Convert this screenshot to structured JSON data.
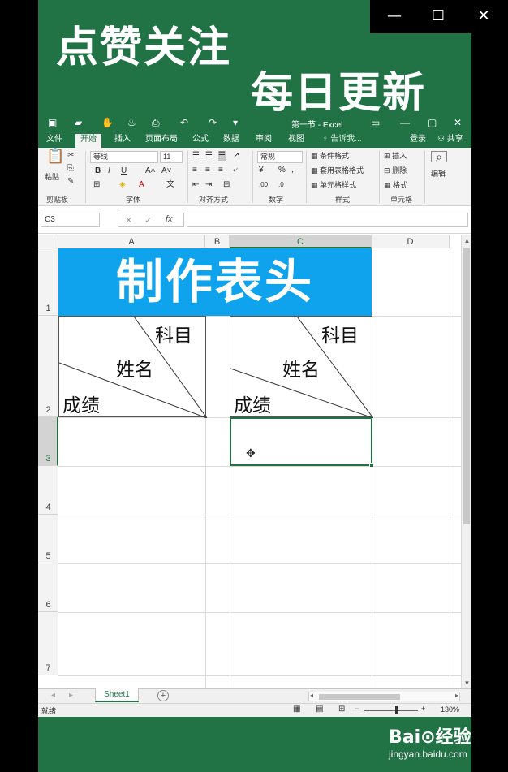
{
  "window_controls": {
    "minimize": "—",
    "maximize": "☐",
    "close": "✕"
  },
  "promo": {
    "line1": "点赞关注",
    "line2": "每日更新"
  },
  "excel": {
    "title": "第一节 - Excel",
    "ribbon_tabs": [
      "文件",
      "开始",
      "插入",
      "页面布局",
      "公式",
      "数据",
      "审阅",
      "视图"
    ],
    "tell_me": "♀ 告诉我...",
    "login": "登录",
    "share": "共享",
    "font_name": "等线",
    "font_size": "11",
    "number_format": "常规",
    "groups": {
      "clipboard": "剪贴板",
      "font": "字体",
      "alignment": "对齐方式",
      "number": "数字",
      "styles": "样式",
      "cells": "单元格"
    },
    "styles": {
      "conditional": "条件格式",
      "table": "套用表格格式",
      "cell": "单元格样式"
    },
    "cells": {
      "insert": "插入",
      "delete": "删除",
      "format": "格式"
    },
    "paste": "粘贴",
    "edit": "编辑",
    "name_box": "C3",
    "columns": [
      "A",
      "B",
      "C",
      "D"
    ],
    "rows": [
      "1",
      "2",
      "3",
      "4",
      "5",
      "6",
      "7"
    ],
    "header_cell": "制作表头",
    "diag_labels": {
      "subject": "科目",
      "name": "姓名",
      "score": "成绩"
    },
    "sheet_tab": "Sheet1",
    "status": "就绪",
    "zoom": "130%",
    "colors": {
      "excel_green": "#217346",
      "header_blue": "#0fa3ee"
    }
  },
  "watermark": {
    "logo": "Bai⊙经验",
    "site": "jingyan.baidu.com"
  }
}
